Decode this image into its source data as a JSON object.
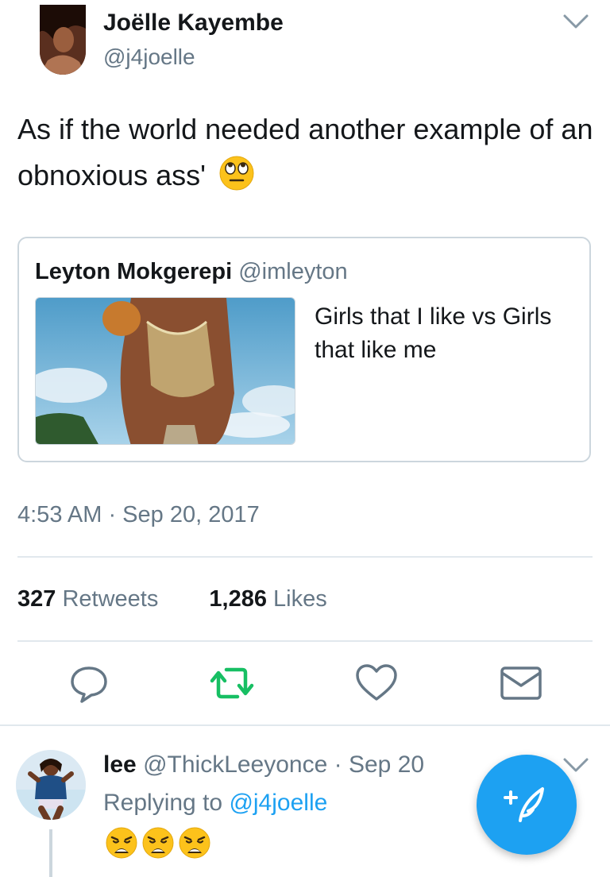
{
  "tweet": {
    "author_name": "Joëlle Kayembe",
    "author_handle": "@j4joelle",
    "text": "As if the world needed another  example of an obnoxious ass'",
    "text_emoji": "face-with-rolling-eyes-emoji",
    "timestamp": "4:53 AM · Sep 20, 2017"
  },
  "quote": {
    "author_name": "Leyton Mokgerepi",
    "author_handle": "@imleyton",
    "text": "Girls that I like vs Girls that like me",
    "image": "photo-thumbnail"
  },
  "stats": {
    "retweets_count": "327",
    "retweets_label": "Retweets",
    "likes_count": "1,286",
    "likes_label": "Likes"
  },
  "actions": {
    "icons": [
      "reply-icon",
      "retweet-icon",
      "like-icon",
      "direct-message-icon"
    ],
    "retweet_active_color": "#17bf63",
    "icon_color": "#657786"
  },
  "reply": {
    "name": "lee",
    "handle": "@ThickLeeyonce",
    "separator": " · ",
    "date": "Sep 20",
    "replying_to_label": "Replying to ",
    "replying_to_handle": "@j4joelle",
    "emoji": [
      "weary-face-emoji",
      "weary-face-emoji",
      "weary-face-emoji"
    ]
  },
  "fab": {
    "icon": "compose-tweet-icon",
    "color": "#1da1f2"
  },
  "colors": {
    "link": "#1da1f2",
    "secondary_text": "#657786",
    "border": "#ccd6dd"
  }
}
